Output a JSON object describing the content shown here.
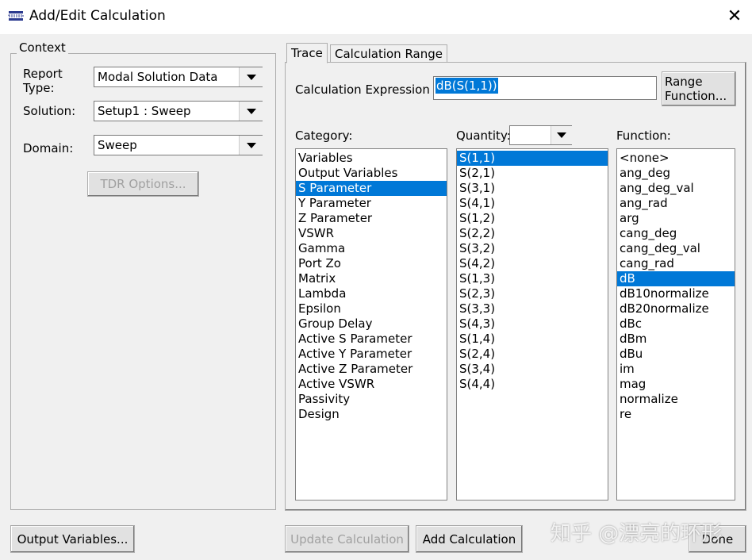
{
  "window": {
    "title": "Add/Edit Calculation",
    "close": "✕"
  },
  "context": {
    "group_label": "Context",
    "report_type_label": "Report Type:",
    "report_type_value": "Modal Solution Data",
    "solution_label": "Solution:",
    "solution_value": "Setup1 : Sweep",
    "domain_label": "Domain:",
    "domain_value": "Sweep",
    "tdr_button": "TDR Options..."
  },
  "tabs": [
    {
      "label": "Trace",
      "active": true
    },
    {
      "label": "Calculation Range",
      "active": false
    }
  ],
  "trace": {
    "expression_label": "Calculation Expression :",
    "expression_value": "dB(S(1,1))",
    "range_function_button": [
      "Range",
      "Function..."
    ],
    "category_label": "Category:",
    "quantity_label": "Quantity:",
    "quantity_filter": "",
    "function_label": "Function:",
    "categories": [
      "Variables",
      "Output Variables",
      "S Parameter",
      "Y Parameter",
      "Z Parameter",
      "VSWR",
      "Gamma",
      "Port Zo",
      "Matrix",
      "Lambda",
      "Epsilon",
      "Group Delay",
      "Active S Parameter",
      "Active Y Parameter",
      "Active Z Parameter",
      "Active VSWR",
      "Passivity",
      "Design"
    ],
    "selected_category": "S Parameter",
    "quantities": [
      "S(1,1)",
      "S(2,1)",
      "S(3,1)",
      "S(4,1)",
      "S(1,2)",
      "S(2,2)",
      "S(3,2)",
      "S(4,2)",
      "S(1,3)",
      "S(2,3)",
      "S(3,3)",
      "S(4,3)",
      "S(1,4)",
      "S(2,4)",
      "S(3,4)",
      "S(4,4)"
    ],
    "selected_quantity": "S(1,1)",
    "functions": [
      "<none>",
      "ang_deg",
      "ang_deg_val",
      "ang_rad",
      "arg",
      "cang_deg",
      "cang_deg_val",
      "cang_rad",
      "dB",
      "dB10normalize",
      "dB20normalize",
      "dBc",
      "dBm",
      "dBu",
      "im",
      "mag",
      "normalize",
      "re"
    ],
    "selected_function": "dB"
  },
  "footer": {
    "output_variables": "Output Variables...",
    "update_calculation": "Update Calculation",
    "add_calculation": "Add Calculation",
    "done": "Done"
  },
  "watermark": "知乎 @漂亮的环形"
}
